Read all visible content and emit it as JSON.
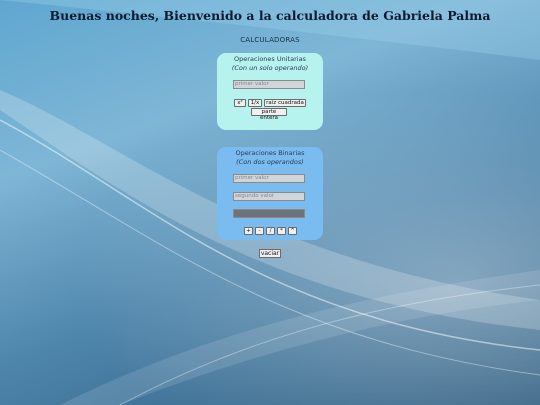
{
  "header": {
    "title": "Buenas noches, Bienvenido a la calculadora de Gabriela Palma",
    "subtitle": "CALCULADORAS"
  },
  "unary": {
    "heading": "Operaciones Unitarias",
    "subheading": "(Con un solo operando)",
    "input_placeholder": "primer valor",
    "buttons": {
      "square": "x²",
      "inverse": "1/x",
      "sqrt": "raiz cuadrada",
      "integer": "parte entera"
    }
  },
  "binary": {
    "heading": "Operaciones Binarias",
    "subheading": "(Con dos operandos)",
    "first_placeholder": "primer valor",
    "second_placeholder": "segundo valor",
    "result_value": "",
    "buttons": {
      "add": "+",
      "sub": "-",
      "div": "/",
      "mul": "*",
      "pow": "^"
    }
  },
  "clear_label": "vaciar",
  "colors": {
    "unary_panel": "#b6f3ef",
    "binary_panel": "#7bbcf0"
  }
}
